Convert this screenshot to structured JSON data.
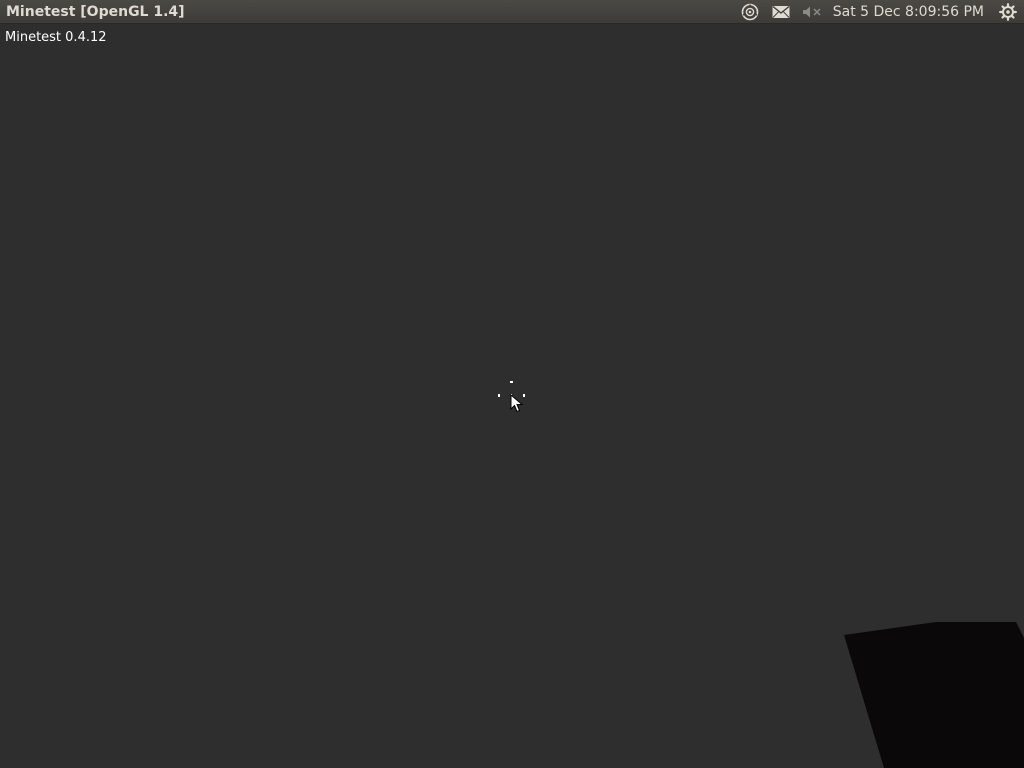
{
  "panel": {
    "window_title": "Minetest [OpenGL 1.4]",
    "clock": "Sat  5 Dec  8:09:56 PM",
    "indicators": [
      {
        "icon": "network-icon"
      },
      {
        "icon": "mail-icon"
      },
      {
        "icon": "sound-muted-icon"
      },
      {
        "icon": "session-gear-icon"
      }
    ],
    "colors": {
      "panel_bg": "#3c3b37",
      "panel_text": "#dfdbd2"
    }
  },
  "game": {
    "version_label": "Minetest 0.4.12",
    "sky_color": "#2e2e2e",
    "held_block_color": "#0b0809",
    "crosshair_color": "#ffffff"
  }
}
